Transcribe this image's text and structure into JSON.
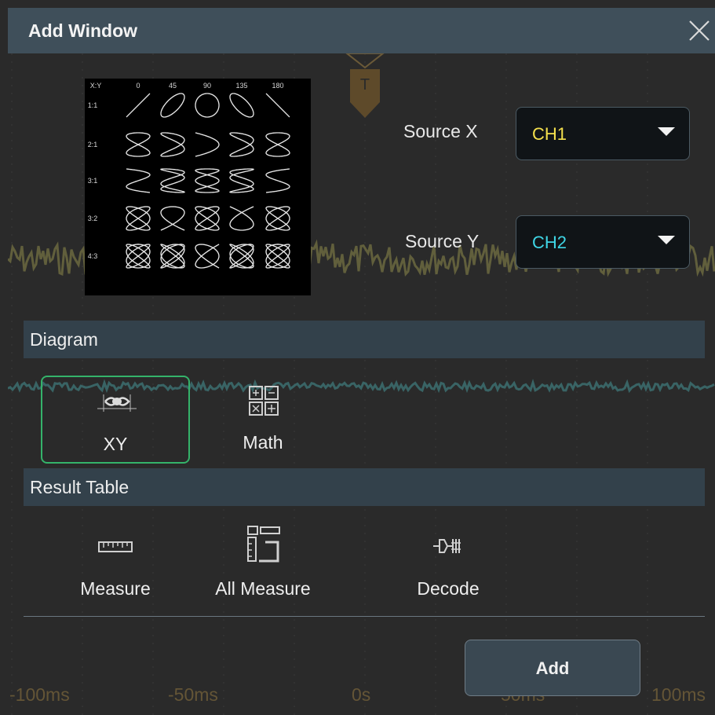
{
  "dialog": {
    "title": "Add Window"
  },
  "preview": {
    "header": [
      "X:Y",
      "0",
      "45",
      "90",
      "135",
      "180"
    ],
    "rows": [
      "1:1",
      "2:1",
      "3:1",
      "3:2",
      "4:3"
    ]
  },
  "sources": {
    "x": {
      "label": "Source X",
      "value": "CH1",
      "color": "#f4e04d"
    },
    "y": {
      "label": "Source Y",
      "value": "CH2",
      "color": "#3fd6e6"
    }
  },
  "sections": {
    "diagram": "Diagram",
    "result_table": "Result Table"
  },
  "diagram_items": [
    {
      "label": "XY",
      "icon": "xy-icon",
      "selected": true
    },
    {
      "label": "Math",
      "icon": "math-grid-icon",
      "selected": false
    }
  ],
  "result_items": [
    {
      "label": "Measure",
      "icon": "ruler-icon"
    },
    {
      "label": "All Measure",
      "icon": "all-measure-icon"
    },
    {
      "label": "Decode",
      "icon": "decode-icon"
    }
  ],
  "actions": {
    "add": "Add"
  },
  "background": {
    "trigger_marker": "T",
    "time_axis": [
      "-100ms",
      "-50ms",
      "0s",
      "50ms",
      "100ms"
    ]
  },
  "colors": {
    "accent": "#34b36a",
    "ch1": "#f4e04d",
    "ch2": "#3fd6e6"
  }
}
